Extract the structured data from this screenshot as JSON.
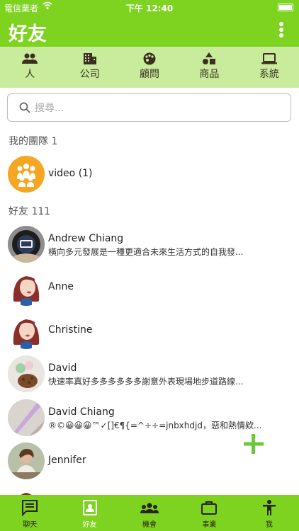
{
  "status_bar": {
    "carrier": "電信業者",
    "time": "下午 12:40"
  },
  "app_bar": {
    "title": "好友"
  },
  "categories": [
    {
      "label": "人",
      "icon": "people-icon"
    },
    {
      "label": "公司",
      "icon": "building-icon"
    },
    {
      "label": "顧問",
      "icon": "palette-icon"
    },
    {
      "label": "商品",
      "icon": "shapes-icon"
    },
    {
      "label": "系統",
      "icon": "laptop-icon"
    }
  ],
  "search": {
    "placeholder": "搜尋..."
  },
  "team_section": {
    "title": "我的團隊 1"
  },
  "team": {
    "name": "video (1)"
  },
  "friends_section": {
    "title": "好友 111"
  },
  "friends": [
    {
      "name": "Andrew Chiang",
      "subtitle": "橫向多元發展是一種更適合未來生活方式的自我發..."
    },
    {
      "name": "Anne",
      "subtitle": ""
    },
    {
      "name": "Christine",
      "subtitle": ""
    },
    {
      "name": "David",
      "subtitle": "快速率真好多多多多多多謝意外表現場地步道路線..."
    },
    {
      "name": "David Chiang",
      "subtitle": "®©😀😀😀™✓[]€¶{=^÷÷=jnbxhdjd，惡和熱情欸..."
    },
    {
      "name": "Jennifer",
      "subtitle": ""
    }
  ],
  "tabs": [
    {
      "label": "聊天",
      "icon": "chat-icon"
    },
    {
      "label": "好友",
      "icon": "contacts-icon",
      "active": true
    },
    {
      "label": "機會",
      "icon": "group-icon"
    },
    {
      "label": "事業",
      "icon": "briefcase-icon"
    },
    {
      "label": "我",
      "icon": "person-icon"
    }
  ],
  "colors": {
    "primary": "#7ed321",
    "category_bg": "#c8eb9c",
    "team_avatar": "#f5a623"
  }
}
